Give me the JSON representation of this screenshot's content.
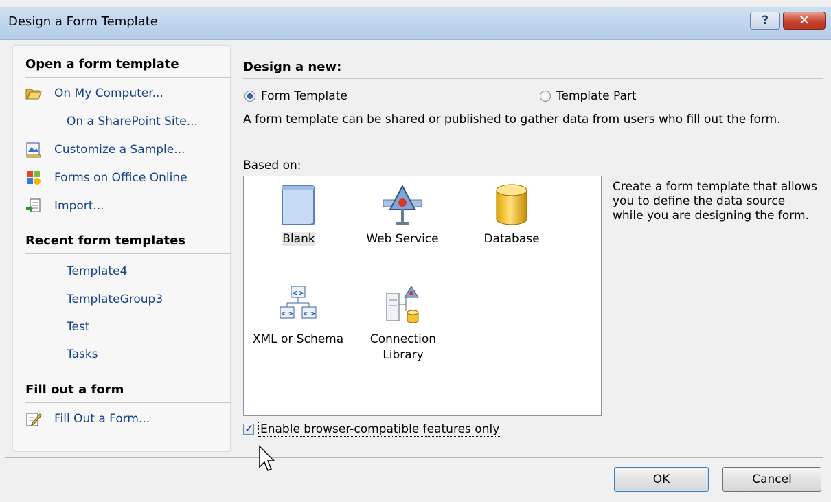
{
  "window": {
    "title": "Design a Form Template",
    "help_glyph": "?",
    "close_glyph": "✕"
  },
  "left": {
    "open_header": "Open a form template",
    "open_items": [
      {
        "label": "On My Computer...",
        "icon": "folder-open-icon"
      },
      {
        "label": "On a SharePoint Site...",
        "icon": ""
      },
      {
        "label": "Customize a Sample...",
        "icon": "sample-form-icon"
      },
      {
        "label": "Forms on Office Online",
        "icon": "office-online-icon"
      },
      {
        "label": "Import...",
        "icon": "import-icon"
      }
    ],
    "recent_header": "Recent form templates",
    "recent_items": [
      "Template4",
      "TemplateGroup3",
      "Test",
      "Tasks"
    ],
    "fill_header": "Fill out a form",
    "fill_item": {
      "label": "Fill Out a Form...",
      "icon": "fill-form-icon"
    }
  },
  "design": {
    "header": "Design a new:",
    "radio_form_template": "Form Template",
    "radio_template_part": "Template Part",
    "selected": "Form Template",
    "description": "A form template can be shared or published to gather data from users who fill out the form.",
    "based_on_label": "Based on:",
    "templates": [
      {
        "label": "Blank",
        "icon": "blank-form-icon",
        "selected": true
      },
      {
        "label": "Web Service",
        "icon": "web-service-icon",
        "selected": false
      },
      {
        "label": "Database",
        "icon": "database-icon",
        "selected": false
      },
      {
        "label": "XML or Schema",
        "icon": "xml-schema-icon",
        "selected": false
      },
      {
        "label": "Connection Library",
        "icon": "connection-library-icon",
        "selected": false
      }
    ],
    "template_description": "Create a form template that allows you to define the data source while you are designing the form.",
    "checkbox_label": "Enable browser-compatible features only",
    "checkbox_checked": true
  },
  "buttons": {
    "ok": "OK",
    "cancel": "Cancel"
  },
  "colors": {
    "link": "#15428b",
    "title_bar": "#c0d5ee",
    "close_button": "#c9432e"
  }
}
